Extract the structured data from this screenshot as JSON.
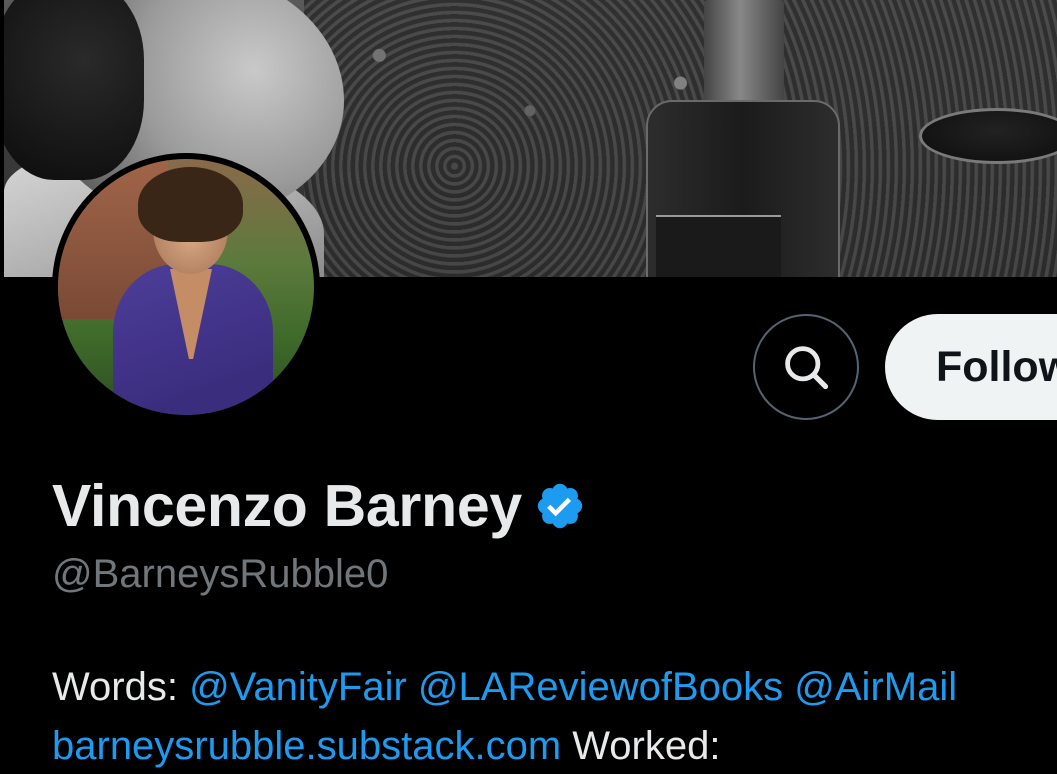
{
  "profile": {
    "display_name": "Vincenzo Barney",
    "handle": "@BarneysRubble0",
    "verified": true,
    "verified_color": "#1d9bf0"
  },
  "actions": {
    "search_icon": "search-icon",
    "follow_label": "Follow"
  },
  "bio": {
    "words_label": "Words:",
    "mention_1": "@VanityFair",
    "mention_2": "@LAReviewofBooks",
    "mention_3": "@AirMail",
    "link": "barneysrubble.substack.com",
    "worked_label": "Worked:"
  },
  "colors": {
    "background": "#000000",
    "text_primary": "#e7e9ea",
    "text_secondary": "#71767b",
    "link": "#1d9bf0",
    "follow_button_bg": "#eff3f4"
  }
}
